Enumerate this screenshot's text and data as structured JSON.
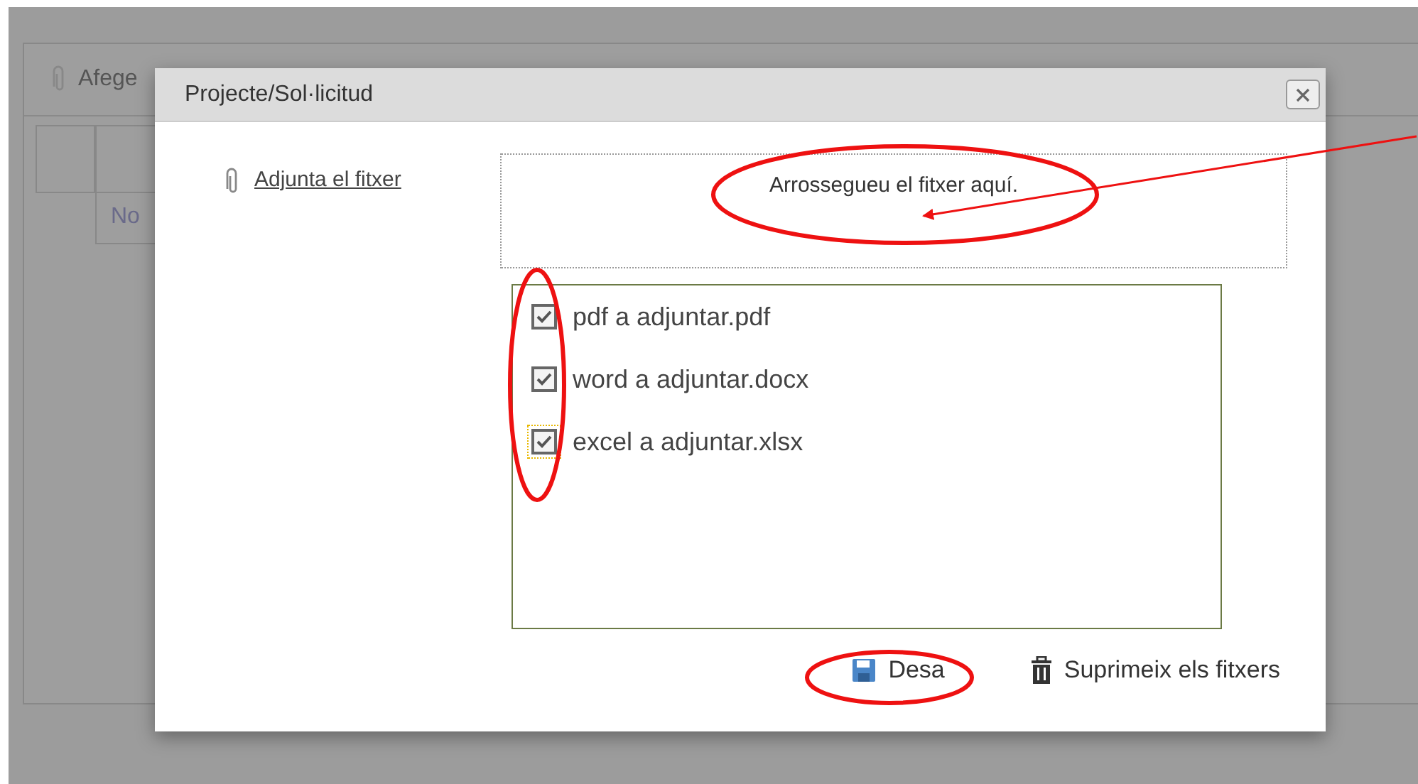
{
  "background_panel": {
    "toolbar_label": "Afege",
    "grid_cell": "No"
  },
  "dialog": {
    "title": "Projecte/Sol·licitud",
    "attach_link": "Adjunta el fitxer",
    "drop_zone": "Arrossegueu el fitxer aquí.",
    "files": [
      {
        "name": "pdf a adjuntar.pdf",
        "checked": true,
        "focused": false
      },
      {
        "name": "word a adjuntar.docx",
        "checked": true,
        "focused": false
      },
      {
        "name": "excel a adjuntar.xlsx",
        "checked": true,
        "focused": true
      }
    ],
    "buttons": [
      {
        "kind": "save",
        "label": "Desa"
      },
      {
        "kind": "delete",
        "label": "Suprimeix els fitxers"
      }
    ]
  }
}
